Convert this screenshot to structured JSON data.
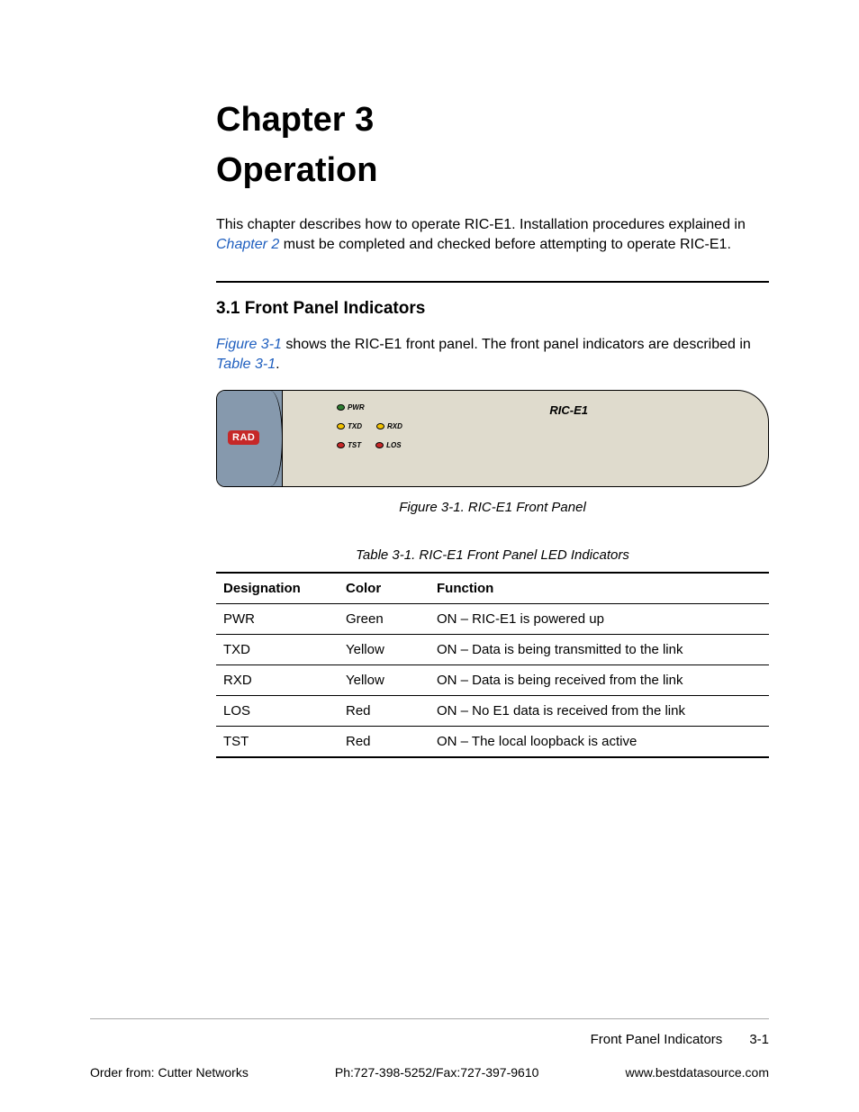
{
  "chapter": {
    "number_label": "Chapter 3",
    "title": "Operation"
  },
  "intro": {
    "pre": "This chapter describes how to operate RIC-E1. Installation procedures explained in ",
    "link": "Chapter 2",
    "post": " must be completed and checked before attempting to operate RIC-E1."
  },
  "section": {
    "heading": "3.1  Front Panel Indicators"
  },
  "section_body": {
    "link1": "Figure 3-1",
    "mid": " shows the RIC-E1 front panel. The front panel indicators are described in ",
    "link2": "Table 3-1",
    "tail": "."
  },
  "device": {
    "badge": "RAD",
    "product": "RIC-E1",
    "leds": {
      "pwr": "PWR",
      "txd": "TXD",
      "rxd": "RXD",
      "tst": "TST",
      "los": "LOS"
    }
  },
  "figure_caption": "Figure 3-1.  RIC-E1 Front Panel",
  "table_caption": "Table 3-1.  RIC-E1 Front Panel LED Indicators",
  "table": {
    "headers": {
      "c1": "Designation",
      "c2": "Color",
      "c3": "Function"
    },
    "rows": [
      {
        "d": "PWR",
        "c": "Green",
        "f": "ON – RIC-E1 is powered up"
      },
      {
        "d": "TXD",
        "c": "Yellow",
        "f": "ON – Data is being transmitted to the link"
      },
      {
        "d": "RXD",
        "c": "Yellow",
        "f": "ON – Data is being received from the link"
      },
      {
        "d": "LOS",
        "c": "Red",
        "f": "ON – No E1 data is received from the link"
      },
      {
        "d": "TST",
        "c": "Red",
        "f": "ON – The local loopback is active"
      }
    ]
  },
  "footer": {
    "section": "Front Panel Indicators",
    "page": "3-1",
    "order": "Order from: Cutter Networks",
    "phone": "Ph:727-398-5252/Fax:727-397-9610",
    "url": "www.bestdatasource.com"
  }
}
